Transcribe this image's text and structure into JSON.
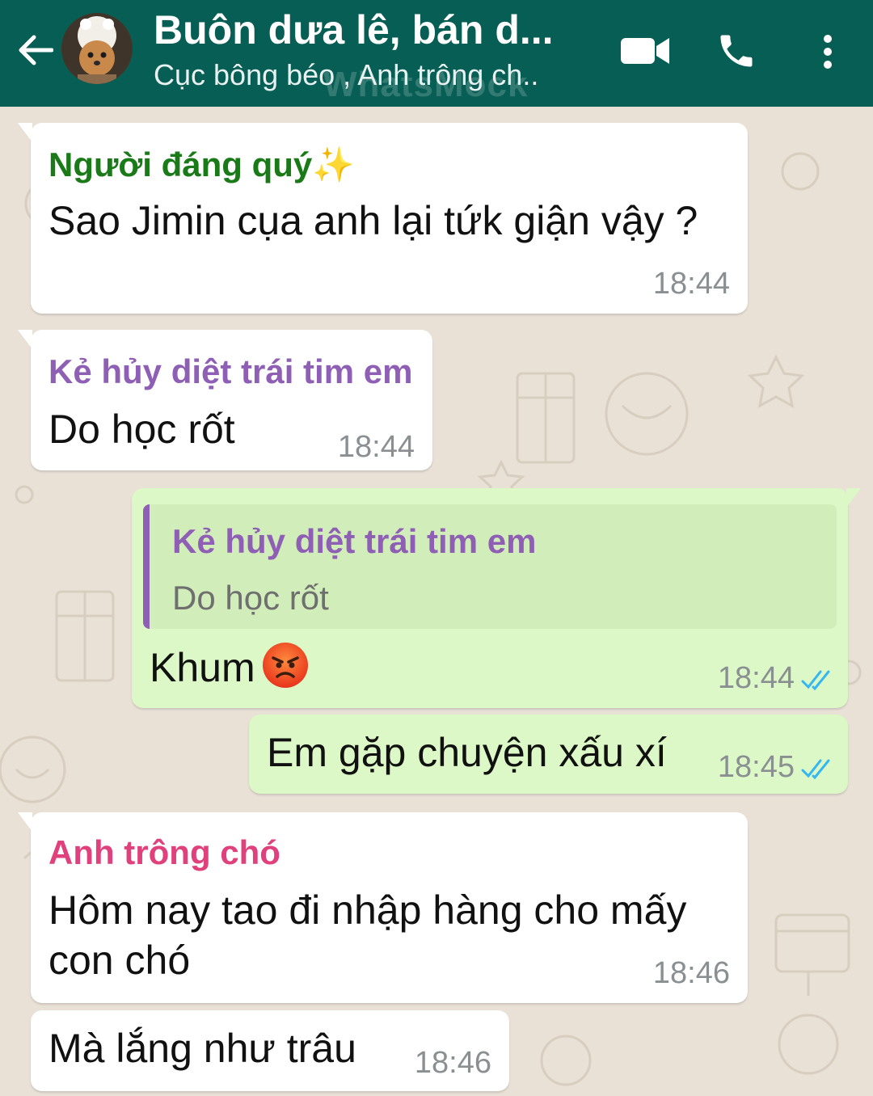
{
  "header": {
    "title": "Buôn dưa lê, bán d...",
    "subtitle": "Cục bông béo , Anh trông ch..",
    "watermark": "WhatsMock"
  },
  "colors": {
    "header_bg": "#075e54",
    "incoming_bubble": "#ffffff",
    "outgoing_bubble": "#dcf8c6",
    "sender_green": "#1a7a18",
    "sender_purple": "#8e5fb4",
    "sender_pink": "#e0407b",
    "read_ticks": "#34b7f1"
  },
  "messages": [
    {
      "direction": "in",
      "sender": "Người đáng quý✨",
      "text": "Sao Jimin cụa anh lại tứk giận vậy ?",
      "time": "18:44"
    },
    {
      "direction": "in",
      "sender": "Kẻ hủy diệt trái tim em",
      "text": "Do học rốt",
      "time": "18:44"
    },
    {
      "direction": "out",
      "quoted_sender": "Kẻ hủy diệt trái tim em",
      "quoted_text": "Do học rốt",
      "text": "Khum",
      "emoji": "angry-face",
      "time": "18:44",
      "status": "read"
    },
    {
      "direction": "out",
      "text": "Em gặp chuyện xấu xí",
      "time": "18:45",
      "status": "read"
    },
    {
      "direction": "in",
      "sender": "Anh trông chó",
      "text_line1": "Hôm nay tao đi nhập hàng cho mấy",
      "text_line2": "con chó",
      "time": "18:46"
    },
    {
      "direction": "in",
      "text": "Mà lắng như trâu",
      "time": "18:46"
    }
  ]
}
